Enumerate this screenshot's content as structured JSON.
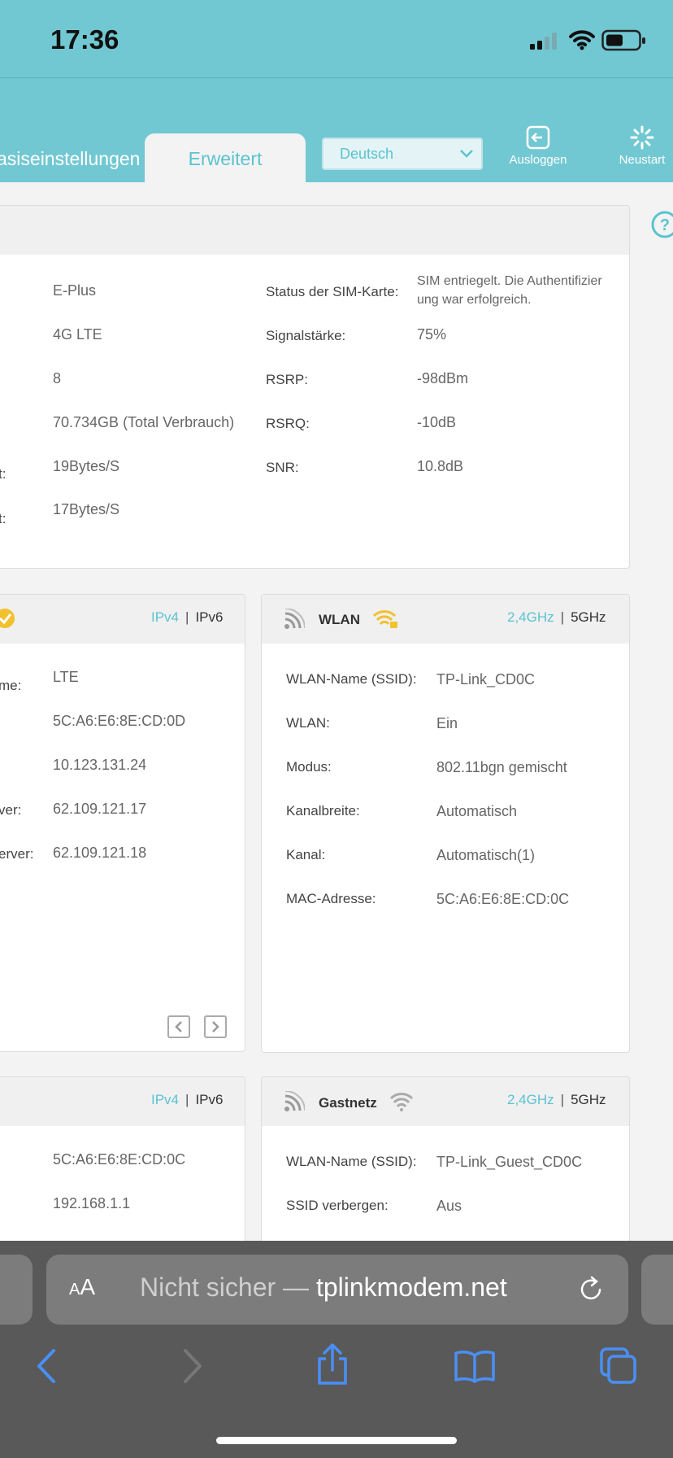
{
  "status_bar": {
    "time": "17:36"
  },
  "header": {
    "tab_basic": "asiseinstellungen",
    "tab_advanced": "Erweitert",
    "language": "Deutsch",
    "logout_label": "Ausloggen",
    "restart_label": "Neustart",
    "colors": {
      "header_bg": "#72c8d2",
      "accent": "#5bc3cf"
    }
  },
  "mobile": {
    "rows": [
      {
        "label": "",
        "value": "E-Plus"
      },
      {
        "label": "",
        "value": "4G LTE"
      },
      {
        "label": "",
        "value": "8"
      },
      {
        "label": "",
        "value": "70.734GB (Total Verbrauch)"
      },
      {
        "label": "t:",
        "value": "19Bytes/S"
      },
      {
        "label": "t:",
        "value": "17Bytes/S"
      }
    ],
    "right_rows": [
      {
        "label": "Status der SIM-Karte:",
        "value": "SIM entriegelt. Die Authentifizierung war erfolgreich."
      },
      {
        "label": "Signalstärke:",
        "value": "75%"
      },
      {
        "label": "RSRP:",
        "value": "-98dBm"
      },
      {
        "label": "RSRQ:",
        "value": "-10dB"
      },
      {
        "label": "SNR:",
        "value": "10.8dB"
      }
    ]
  },
  "internet": {
    "ipv4": "IPv4",
    "ipv6": "IPv6",
    "rows": [
      {
        "label": "me:",
        "value": "LTE"
      },
      {
        "label": "",
        "value": "5C:A6:E6:8E:CD:0D"
      },
      {
        "label": "",
        "value": "10.123.131.24"
      },
      {
        "label": "ver:",
        "value": "62.109.121.17"
      },
      {
        "label": "erver:",
        "value": "62.109.121.18"
      }
    ]
  },
  "wlan": {
    "title": "WLAN",
    "band_24": "2,4GHz",
    "band_5": "5GHz",
    "rows": [
      {
        "label": "WLAN-Name (SSID):",
        "value": "TP-Link_CD0C"
      },
      {
        "label": "WLAN:",
        "value": "Ein"
      },
      {
        "label": "Modus:",
        "value": "802.11bgn gemischt"
      },
      {
        "label": "Kanalbreite:",
        "value": "Automatisch"
      },
      {
        "label": "Kanal:",
        "value": "Automatisch(1)"
      },
      {
        "label": "MAC-Adresse:",
        "value": "5C:A6:E6:8E:CD:0C"
      }
    ]
  },
  "lan": {
    "ipv4": "IPv4",
    "ipv6": "IPv6",
    "rows": [
      {
        "value": "5C:A6:E6:8E:CD:0C"
      },
      {
        "value": "192.168.1.1"
      }
    ]
  },
  "guest": {
    "title": "Gastnetz",
    "band_24": "2,4GHz",
    "band_5": "5GHz",
    "rows": [
      {
        "label": "WLAN-Name (SSID):",
        "value": "TP-Link_Guest_CD0C"
      },
      {
        "label": "SSID verbergen:",
        "value": "Aus"
      }
    ]
  },
  "browser": {
    "aa_big": "A",
    "aa_small": "A",
    "url_prefix": "Nicht sicher — ",
    "url_host": "tplinkmodem.net"
  }
}
